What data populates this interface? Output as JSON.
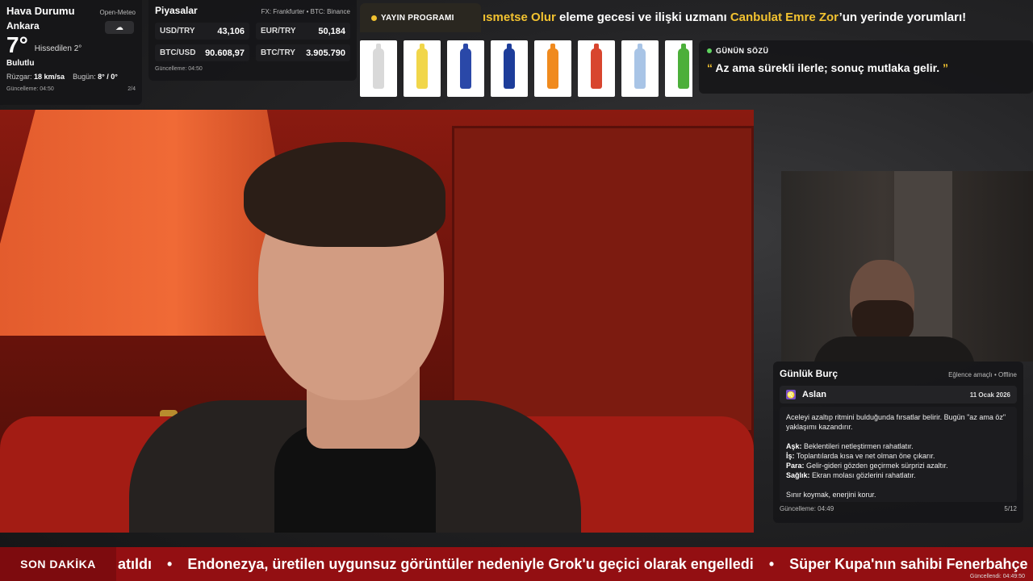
{
  "weather": {
    "title": "Hava Durumu",
    "source": "Open-Meteo",
    "city": "Ankara",
    "temp": "7°",
    "feels_like": "Hissedilen 2°",
    "condition": "Bulutlu",
    "condition_icon": "cloud-icon",
    "wind_label": "Rüzgar:",
    "wind_value": "18 km/sa",
    "today_label": "Bugün:",
    "today_value": "8° / 0°",
    "updated": "Güncelleme: 04:50",
    "page": "2/4"
  },
  "markets": {
    "title": "Piyasalar",
    "source": "FX: Frankfurter • BTC: Binance",
    "items": [
      {
        "symbol": "USD/TRY",
        "value": "43,106"
      },
      {
        "symbol": "EUR/TRY",
        "value": "50,184"
      },
      {
        "symbol": "BTC/USD",
        "value": "90.608,97"
      },
      {
        "symbol": "BTC/TRY",
        "value": "3.905.790"
      }
    ],
    "updated": "Güncelleme: 04:50"
  },
  "schedule": {
    "label": "YAYIN PROGRAMI"
  },
  "top_ticker": {
    "part1": "ısmetse Olur",
    "part2": " eleme gecesi ve ilişki uzmanı ",
    "part3": "Canbulat Emre Zor",
    "part4": "’un yerinde yorumları!"
  },
  "products": [
    {
      "name": "water-bottle-icon",
      "color": "#d9d9d9"
    },
    {
      "name": "lemon-soda-bottle-icon",
      "color": "#f1d64a"
    },
    {
      "name": "deep-can-icon",
      "color": "#2a48a8"
    },
    {
      "name": "blue-bottles-icon",
      "color": "#1d3d9a"
    },
    {
      "name": "orange-soda-bottle-icon",
      "color": "#f08a1e"
    },
    {
      "name": "soda-multipack-icon",
      "color": "#d8452e"
    },
    {
      "name": "mineral-water-bottles-icon",
      "color": "#a8c4e6"
    },
    {
      "name": "green-soda-bottle-icon",
      "color": "#4caf3a"
    }
  ],
  "quote": {
    "label": "GÜNÜN SÖZÜ",
    "open": "“",
    "text": " Az ama sürekli ilerle; sonuç mutlaka gelir. ",
    "close": "”"
  },
  "horoscope": {
    "title": "Günlük Burç",
    "status": "Eğlence amaçlı • Offline",
    "sign_icon": "leo-icon",
    "sign": "Aslan",
    "date": "11 Ocak 2026",
    "intro": "Aceleyi azaltıp ritmini bulduğunda fırsatlar belirir. Bugün \"az ama öz\" yaklaşımı kazandırır.",
    "love_label": "Aşk:",
    "love": " Beklentileri netleştirmen rahatlatır.",
    "work_label": "İş:",
    "work": " Toplantılarda kısa ve net olman öne çıkarır.",
    "money_label": "Para:",
    "money": " Gelir-gideri gözden geçirmek sürprizi azaltır.",
    "health_label": "Sağlık:",
    "health": " Ekran molası gözlerini rahatlatır.",
    "advice": "Sınır koymak, enerjini korur.",
    "updated": "Güncelleme: 04:49",
    "page": "5/12"
  },
  "breaking": {
    "label": "SON DAKİKA",
    "items": [
      "atıldı",
      "Endonezya, üretilen uygunsuz görüntüler nedeniyle Grok'u geçici olarak engelledi",
      "Süper Kupa'nın sahibi Fenerbahçe"
    ],
    "separator": "•",
    "updated": "Güncellendi: 04:49:50"
  }
}
